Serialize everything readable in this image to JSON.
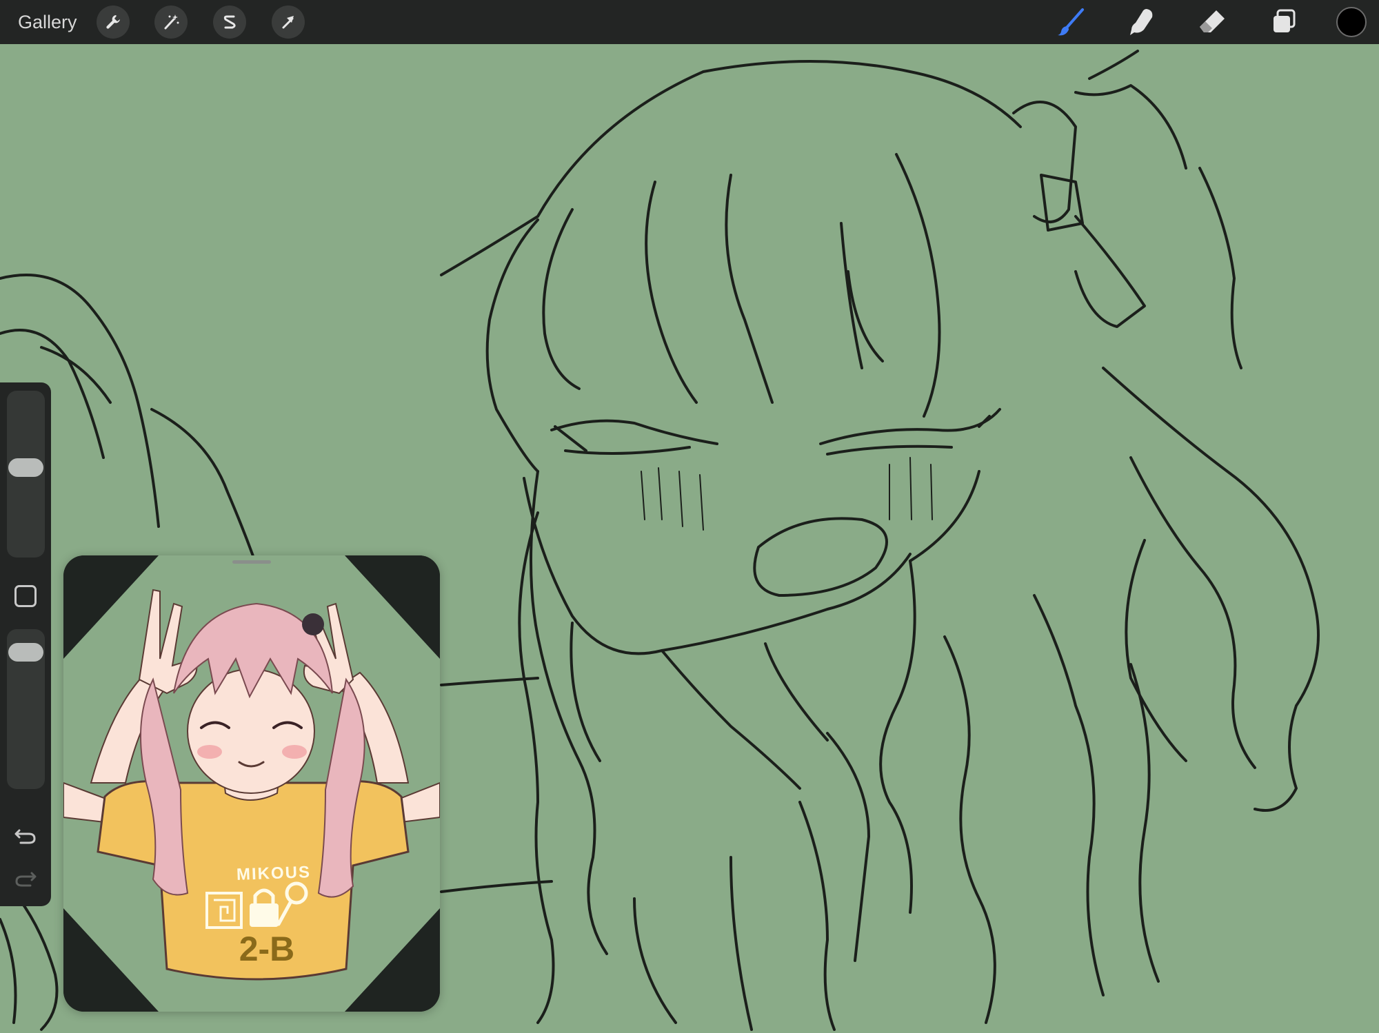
{
  "toolbar": {
    "gallery_label": "Gallery",
    "left_actions": [
      {
        "name": "actions",
        "icon": "wrench-icon"
      },
      {
        "name": "adjustments",
        "icon": "magic-wand-icon"
      },
      {
        "name": "selection",
        "icon": "selection-s-icon"
      },
      {
        "name": "transform",
        "icon": "arrow-cursor-icon"
      }
    ],
    "right_tools": [
      {
        "name": "brush",
        "icon": "brush-icon",
        "active": true
      },
      {
        "name": "smudge",
        "icon": "smudge-finger-icon",
        "active": false
      },
      {
        "name": "eraser",
        "icon": "eraser-icon",
        "active": false
      },
      {
        "name": "layers",
        "icon": "layers-icon",
        "active": false
      }
    ],
    "active_color": "#000000",
    "active_tool_color": "#3e7bf5"
  },
  "sidebar": {
    "brush_size_level": 0.55,
    "opacity_level": 0.85,
    "modifier_icon": "square-modifier-icon",
    "undo_icon": "undo-icon",
    "redo_icon": "redo-icon"
  },
  "canvas": {
    "background_color": "#8aab88",
    "line_color": "#1b1f1b"
  },
  "reference": {
    "shirt_text": "MIKOUS",
    "shirt_class": "2-B",
    "background_color": "#8aab88",
    "hair_color": "#e9b6bd",
    "shirt_color": "#f2c25d"
  }
}
